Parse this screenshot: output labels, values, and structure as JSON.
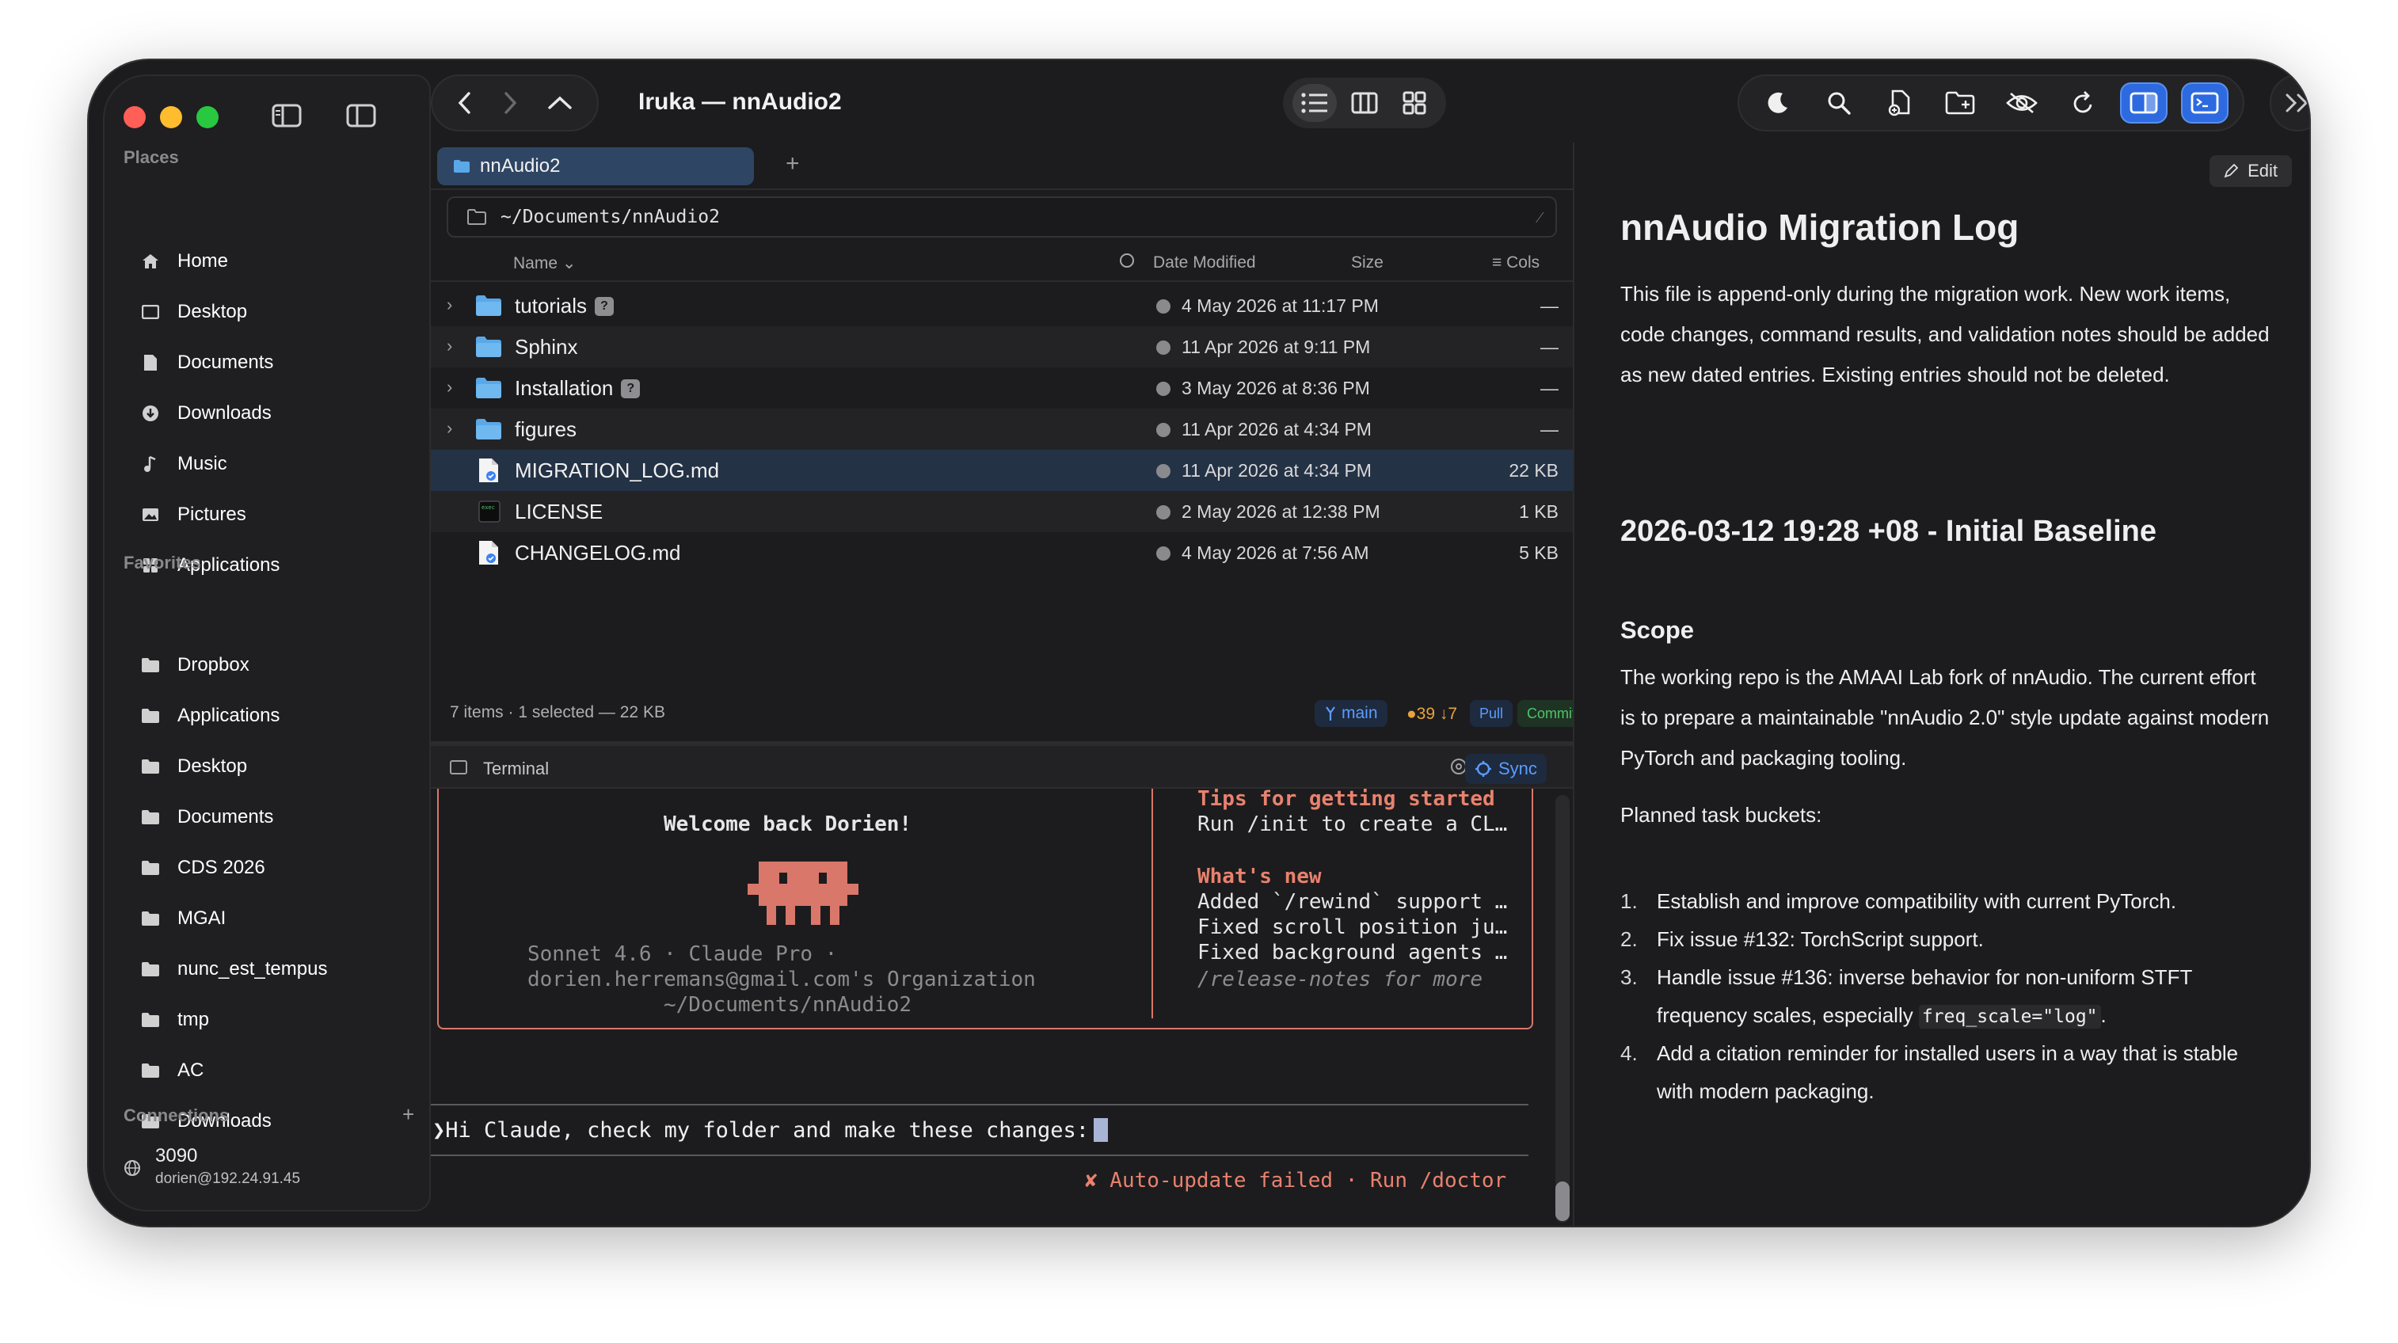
{
  "window": {
    "title": "Iruka — nnAudio2"
  },
  "sidebar": {
    "places_header": "Places",
    "places": [
      {
        "label": "Home",
        "icon": "home-icon"
      },
      {
        "label": "Desktop",
        "icon": "desktop-icon"
      },
      {
        "label": "Documents",
        "icon": "document-icon"
      },
      {
        "label": "Downloads",
        "icon": "download-icon"
      },
      {
        "label": "Music",
        "icon": "music-icon"
      },
      {
        "label": "Pictures",
        "icon": "pictures-icon"
      },
      {
        "label": "Applications",
        "icon": "applications-icon"
      }
    ],
    "favorites_header": "Favorites",
    "favorites": [
      {
        "label": "Dropbox"
      },
      {
        "label": "Applications"
      },
      {
        "label": "Desktop"
      },
      {
        "label": "Documents"
      },
      {
        "label": "CDS 2026"
      },
      {
        "label": "MGAI"
      },
      {
        "label": "nunc_est_tempus"
      },
      {
        "label": "tmp"
      },
      {
        "label": "AC"
      },
      {
        "label": "Downloads"
      }
    ],
    "connections_header": "Connections",
    "connections_add": "+",
    "connection": {
      "name": "3090",
      "address": "dorien@192.24.91.45"
    }
  },
  "tabs": [
    {
      "label": "nnAudio2"
    }
  ],
  "tab_add": "+",
  "path": "~/Documents/nnAudio2",
  "columns": {
    "name": "Name",
    "date": "Date Modified",
    "size": "Size",
    "cols": "Cols"
  },
  "files": [
    {
      "name": "tutorials",
      "type": "folder",
      "badge": "?",
      "date": "4 May 2026 at 11:17 PM",
      "size": "—"
    },
    {
      "name": "Sphinx",
      "type": "folder",
      "badge": "",
      "date": "11 Apr 2026 at 9:11 PM",
      "size": "—"
    },
    {
      "name": "Installation",
      "type": "folder",
      "badge": "?",
      "date": "3 May 2026 at 8:36 PM",
      "size": "—"
    },
    {
      "name": "figures",
      "type": "folder",
      "badge": "",
      "date": "11 Apr 2026 at 4:34 PM",
      "size": "—"
    },
    {
      "name": "MIGRATION_LOG.md",
      "type": "md",
      "badge": "",
      "date": "11 Apr 2026 at 4:34 PM",
      "size": "22 KB"
    },
    {
      "name": "LICENSE",
      "type": "exec",
      "badge": "",
      "date": "2 May 2026 at 12:38 PM",
      "size": "1 KB"
    },
    {
      "name": "CHANGELOG.md",
      "type": "md",
      "badge": "",
      "date": "4 May 2026 at 7:56 AM",
      "size": "5 KB"
    }
  ],
  "status": {
    "summary": "7 items  · 1 selected — 22 KB",
    "branch": "main",
    "ahead": "●39",
    "behind": "↓7",
    "pull": "Pull",
    "commit": "Commit..."
  },
  "terminal": {
    "label": "Terminal",
    "sync": "Sync",
    "welcome": "Welcome back Dorien!",
    "model_line": "Sonnet 4.6 · Claude Pro ·",
    "org_line": "dorien.herremans@gmail.com's Organization",
    "cwd_line": "~/Documents/nnAudio2",
    "tips_title": "Tips for getting started",
    "tips_line": "Run /init to create a CL…",
    "whatsnew_title": "What's new",
    "news": [
      "Added `/rewind` support …",
      "Fixed scroll position ju…",
      "Fixed background agents …"
    ],
    "release_notes": "/release-notes for more",
    "prompt_symbol": "❯",
    "prompt_text": "Hi Claude, check my folder and make these changes:",
    "update_error": "✘ Auto-update failed · Run /doctor"
  },
  "preview": {
    "edit_label": "Edit",
    "h1": "nnAudio Migration Log",
    "intro": "This file is append-only during the migration work. New work items, code changes, command results, and validation notes should be added as new dated entries. Existing entries should not be deleted.",
    "h2": "2026-03-12 19:28 +08 - Initial Baseline",
    "h3": "Scope",
    "scope": "The working repo is the AMAAI Lab fork of nnAudio. The current effort is to prepare a maintainable \"nnAudio 2.0\" style update against modern PyTorch and packaging tooling.",
    "planned": "Planned task buckets:",
    "tasks": [
      {
        "n": "1.",
        "text": "Establish and improve compatibility with current PyTorch."
      },
      {
        "n": "2.",
        "text": "Fix issue #132: TorchScript support."
      },
      {
        "n": "3.",
        "text_a": "Handle issue #136: inverse behavior for non-uniform STFT frequency scales, especially ",
        "code": "freq_scale=\"log\"",
        "text_b": "."
      },
      {
        "n": "4.",
        "text": "Add a citation reminder for installed users in a way that is stable with modern packaging."
      }
    ]
  },
  "colors": {
    "accent": "#2d6ae0",
    "selection": "#243246",
    "terminal_orange": "#d9776a",
    "folder_blue": "#5aa8e8"
  }
}
